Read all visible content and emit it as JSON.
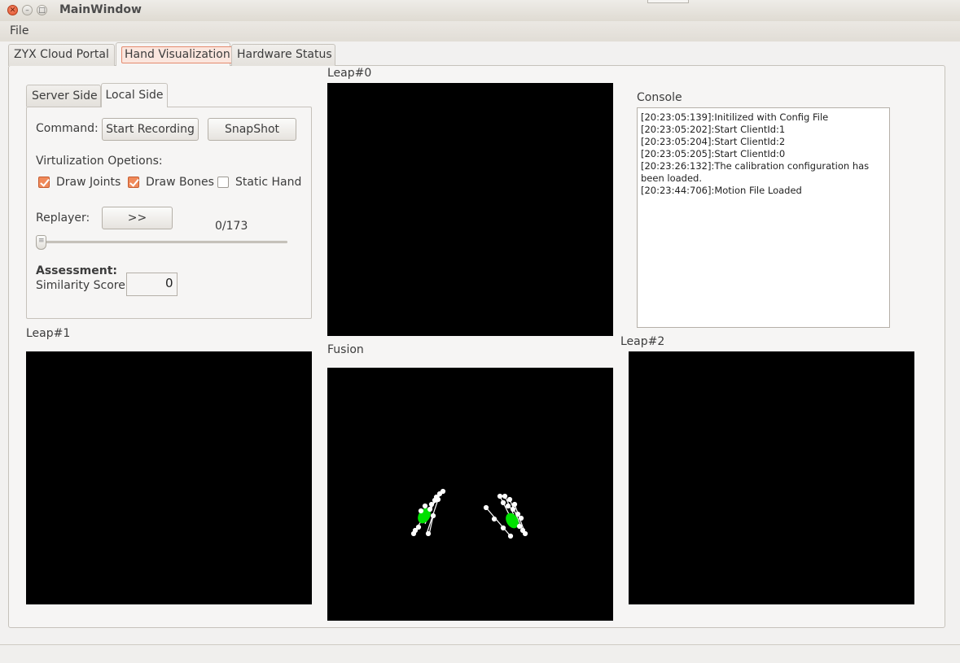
{
  "window": {
    "title": "MainWindow"
  },
  "menu": {
    "file": "File"
  },
  "tabs": [
    {
      "label": "ZYX Cloud Portal"
    },
    {
      "label": "Hand Visualization"
    },
    {
      "label": "Hardware Status"
    }
  ],
  "subtabs": [
    {
      "label": "Server Side"
    },
    {
      "label": "Local Side"
    }
  ],
  "local": {
    "command_label": "Command:",
    "start_recording": "Start Recording",
    "snapshot": "SnapShot",
    "options_label": "Virtulization Opetions:",
    "draw_joints": {
      "label": "Draw Joints",
      "checked": true
    },
    "draw_bones": {
      "label": "Draw Bones",
      "checked": true
    },
    "static_hand": {
      "label": "Static Hand",
      "checked": false
    },
    "replayer_label": "Replayer:",
    "play_button": ">>",
    "frame_counter": "0/173",
    "slider_value": 0,
    "assessment_label": "Assessment:",
    "similarity_label": "Similarity Score:",
    "similarity_value": "0"
  },
  "views": {
    "leap0": "Leap#0",
    "leap1": "Leap#1",
    "leap2": "Leap#2",
    "fusion": "Fusion"
  },
  "console": {
    "title": "Console",
    "lines": [
      "[20:23:05:139]:Initilized with Config File",
      "[20:23:05:202]:Start ClientId:1",
      "[20:23:05:204]:Start ClientId:2",
      "[20:23:05:205]:Start ClientId:0",
      "[20:23:26:132]:The calibration configuration has been loaded.",
      "[20:23:44:706]:Motion File Loaded"
    ]
  },
  "colors": {
    "accent": "#f08a5a",
    "palm": "#00e000",
    "joint": "#ffffff",
    "view_bg": "#000000"
  }
}
